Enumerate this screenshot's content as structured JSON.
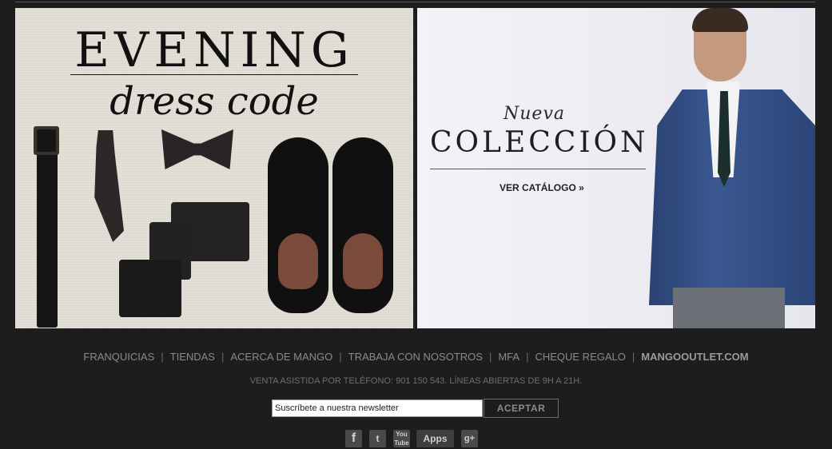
{
  "banner_left": {
    "title": "EVENING",
    "subtitle": "dress code"
  },
  "banner_right": {
    "kicker": "Nueva",
    "title": "COLECCIÓN",
    "cta": "VER CATÁLOGO »"
  },
  "footer": {
    "links": [
      "FRANQUICIAS",
      "TIENDAS",
      "ACERCA DE MANGO",
      "TRABAJA CON NOSOTROS",
      "MFA",
      "CHEQUE REGALO",
      "MANGOOUTLET.COM"
    ],
    "separator": "|",
    "phone_text": "VENTA ASISTIDA POR TELÉFONO: 901 150 543. LÍNEAS ABIERTAS DE 9H A 21H."
  },
  "newsletter": {
    "value": "Suscríbete a nuestra newsletter",
    "button_label": "ACEPTAR"
  },
  "social": {
    "facebook": "f",
    "twitter": "t",
    "youtube": "You Tube",
    "apps": "Apps",
    "googleplus": "g+"
  },
  "colors": {
    "background": "#1d1d1d",
    "footer_text": "#8a8a8a"
  }
}
